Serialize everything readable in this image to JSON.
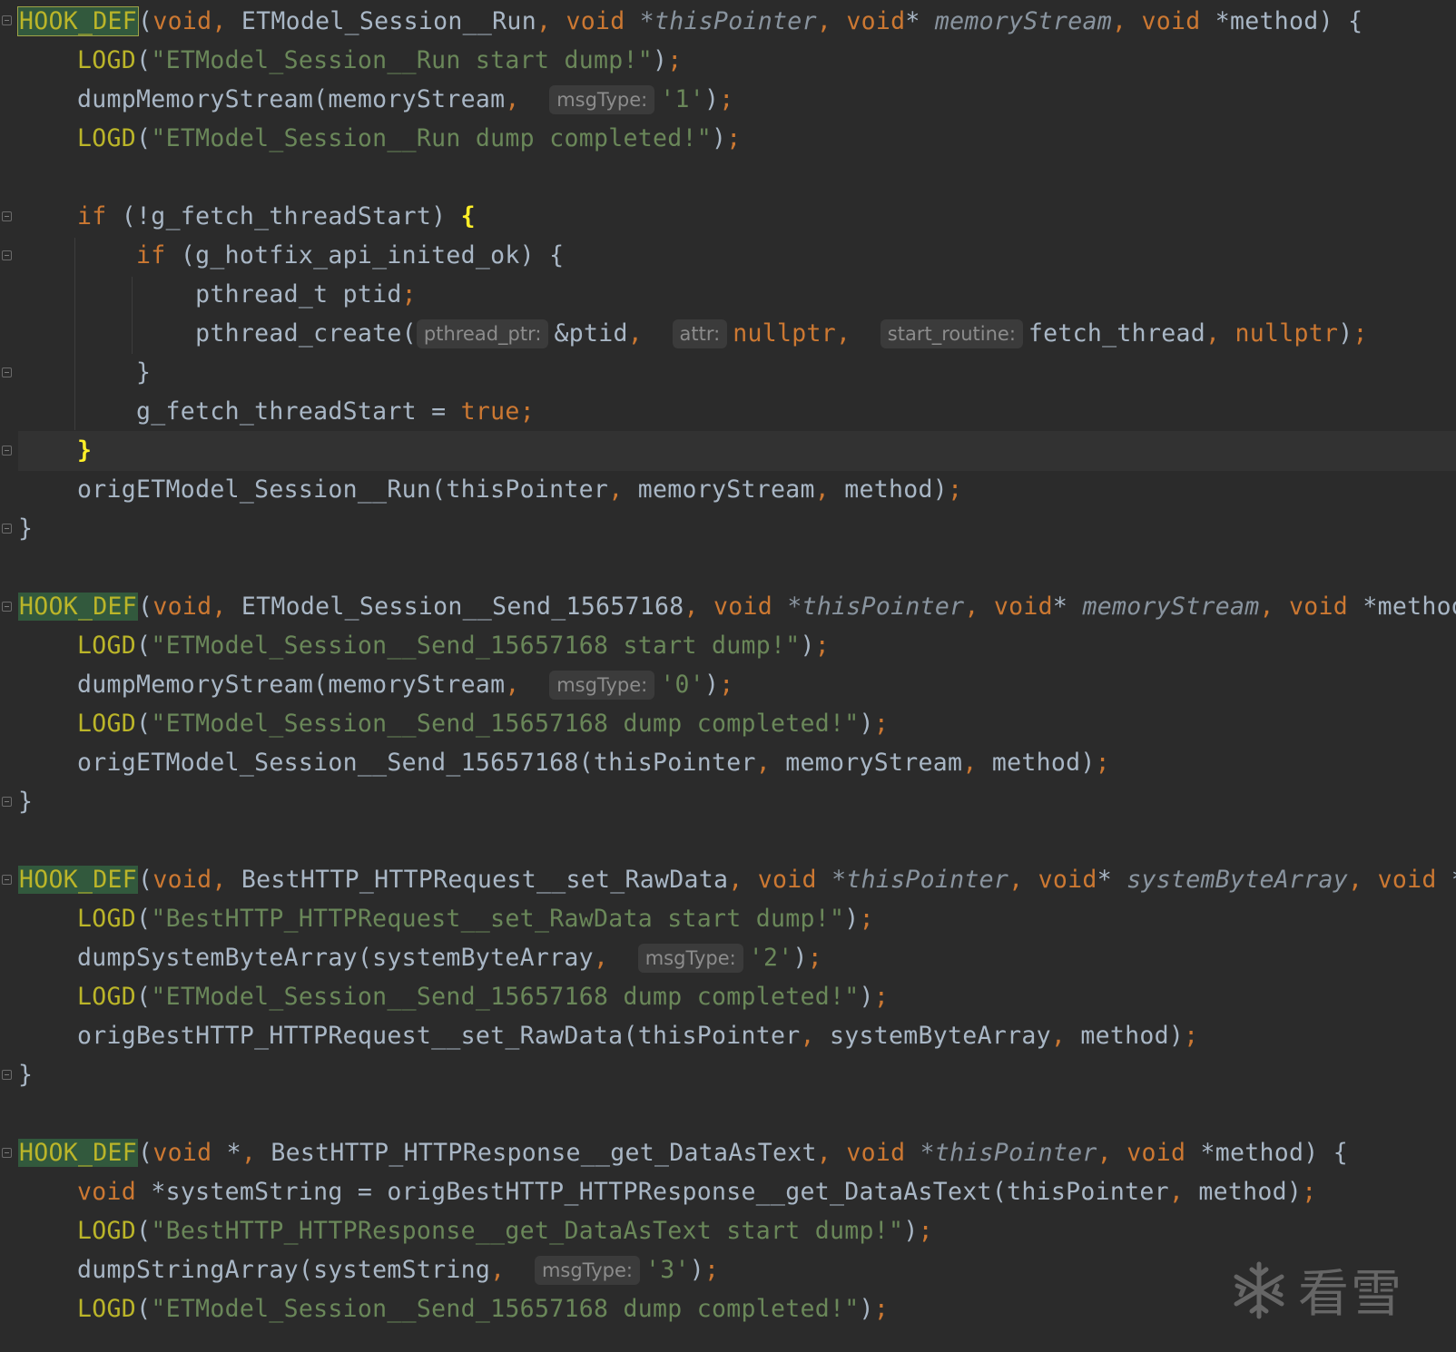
{
  "editor": {
    "blocks": {
      "run": {
        "hook": "HOOK_DEF",
        "sig_open": "(",
        "ret": "void",
        "name": "ETModel_Session__Run",
        "p1_type": "void",
        "p1_name": "*thisPointer",
        "p2_type": "void",
        "p2_star": "*",
        "p2_name": "memoryStream",
        "p3_type": "void",
        "p3_name": "*method",
        "sig_close": ") {",
        "log1_fn": "LOGD",
        "log1_str": "\"ETModel_Session__Run start dump!\"",
        "dump_fn": "dumpMemoryStream(memoryStream",
        "dump_hint": "msgType:",
        "dump_val": "'1'",
        "log2_fn": "LOGD",
        "log2_str": "\"ETModel_Session__Run dump completed!\"",
        "if1_kw": "if",
        "if1_cond": " (!g_fetch_threadStart) ",
        "if2_kw": "if",
        "if2_cond": " (g_hotfix_api_inited_ok) {",
        "decl": "pthread_t ptid",
        "create_fn": "pthread_create(",
        "hint_ptr": "pthread_ptr:",
        "arg_ptid": "&ptid",
        "hint_attr": "attr:",
        "arg_null1": "nullptr",
        "hint_start": "start_routine:",
        "arg_fetch": "fetch_thread",
        "arg_null2": "nullptr",
        "close_inner": "}",
        "assign_lhs": "g_fetch_threadStart = ",
        "assign_val": "true",
        "close_if": "}",
        "orig_call": "origETModel_Session__Run(thisPointer",
        "orig_a2": " memoryStream",
        "orig_a3": " method)",
        "close_fn": "}"
      },
      "send": {
        "hook": "HOOK_DEF",
        "ret": "void",
        "name": "ETModel_Session__Send_15657168",
        "p1_type": "void",
        "p1_name": "*thisPointer",
        "p2_type": "void",
        "p2_star": "*",
        "p2_name": "memoryStream",
        "p3_type": "void",
        "p3_name": "*method)",
        "log1_fn": "LOGD",
        "log1_str": "\"ETModel_Session__Send_15657168 start dump!\"",
        "dump_fn": "dumpMemoryStream(memoryStream",
        "dump_hint": "msgType:",
        "dump_val": "'0'",
        "log2_fn": "LOGD",
        "log2_str": "\"ETModel_Session__Send_15657168 dump completed!\"",
        "orig_call": "origETModel_Session__Send_15657168(thisPointer",
        "orig_a2": " memoryStream",
        "orig_a3": " method)",
        "close_fn": "}"
      },
      "rawdata": {
        "hook": "HOOK_DEF",
        "ret": "void",
        "name": "BestHTTP_HTTPRequest__set_RawData",
        "p1_type": "void",
        "p1_name": "*thisPointer",
        "p2_type": "void",
        "p2_star": "*",
        "p2_name": "systemByteArray",
        "p3_type": "void",
        "p3_name": "*m",
        "log1_fn": "LOGD",
        "log1_str": "\"BestHTTP_HTTPRequest__set_RawData start dump!\"",
        "dump_fn": "dumpSystemByteArray(systemByteArray",
        "dump_hint": "msgType:",
        "dump_val": "'2'",
        "log2_fn": "LOGD",
        "log2_str": "\"ETModel_Session__Send_15657168 dump completed!\"",
        "orig_call": "origBestHTTP_HTTPRequest__set_RawData(thisPointer",
        "orig_a2": " systemByteArray",
        "orig_a3": " method)",
        "close_fn": "}"
      },
      "datatext": {
        "hook": "HOOK_DEF",
        "ret": "void",
        "ret_star": " *",
        "name": "BestHTTP_HTTPResponse__get_DataAsText",
        "p1_type": "void",
        "p1_name": "*thisPointer",
        "p3_type": "void",
        "p3_name": "*method",
        "sig_close": ") {",
        "var_type": "void",
        "var_decl": " *systemString = origBestHTTP_HTTPResponse__get_DataAsText(thisPointer",
        "var_a2": " method)",
        "log1_fn": "LOGD",
        "log1_str": "\"BestHTTP_HTTPResponse__get_DataAsText start dump!\"",
        "dump_fn": "dumpStringArray(systemString",
        "dump_hint": "msgType:",
        "dump_val": "'3'",
        "log2_fn": "LOGD",
        "log2_str": "\"ETModel_Session__Send_15657168 dump completed!\""
      }
    }
  },
  "watermark": {
    "text": "看雪",
    "icon": "snowflake-icon"
  },
  "colors": {
    "background": "#2b2b2b",
    "keyword": "#cc7832",
    "macro": "#bbb529",
    "string": "#6a8759",
    "text": "#a9b7c6",
    "hook_bg": "#32593d"
  }
}
